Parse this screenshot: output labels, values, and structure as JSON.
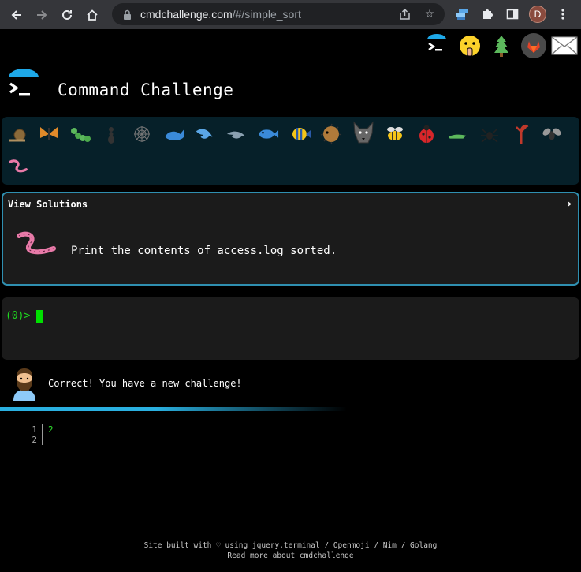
{
  "browser": {
    "url_host": "cmdchallenge.com",
    "url_rest": "/#/simple_sort",
    "profile_initial": "D",
    "icons": [
      "back-icon",
      "forward-icon",
      "reload-icon",
      "home-icon",
      "lock-icon",
      "share-icon",
      "star-icon",
      "extension-stack-icon",
      "puzzle-icon",
      "side-panel-icon",
      "menu-icon"
    ]
  },
  "social": [
    "terminal-logo-icon",
    "shushing-face-icon",
    "tree-icon",
    "gitlab-icon",
    "mail-icon"
  ],
  "site": {
    "title": "Command Challenge"
  },
  "challenges": [
    "snail",
    "butterfly",
    "caterpillar",
    "ant",
    "spider-web",
    "whale",
    "dolphin",
    "dolphin",
    "fish",
    "tropical-fish",
    "blowfish",
    "wolf",
    "bee",
    "ladybug",
    "grasshopper",
    "spider",
    "scorpion",
    "fly",
    "worm"
  ],
  "solutions": {
    "toggle_label": "View Solutions",
    "chevron": "›",
    "task": "Print the contents of access.log sorted."
  },
  "terminal": {
    "prompt": "(0)>"
  },
  "feedback": {
    "message": "Correct! You have a new challenge!"
  },
  "output": {
    "line_numbers": "1\n2",
    "code": "2"
  },
  "footer": {
    "line1": "Site built with ♡ using jquery.terminal / Openmoji / Nim / Golang",
    "line2": "Read more about cmdchallenge"
  },
  "colors": {
    "accent": "#2f8fb0",
    "strip": "#062029",
    "terminal_green": "#1fd81f"
  }
}
